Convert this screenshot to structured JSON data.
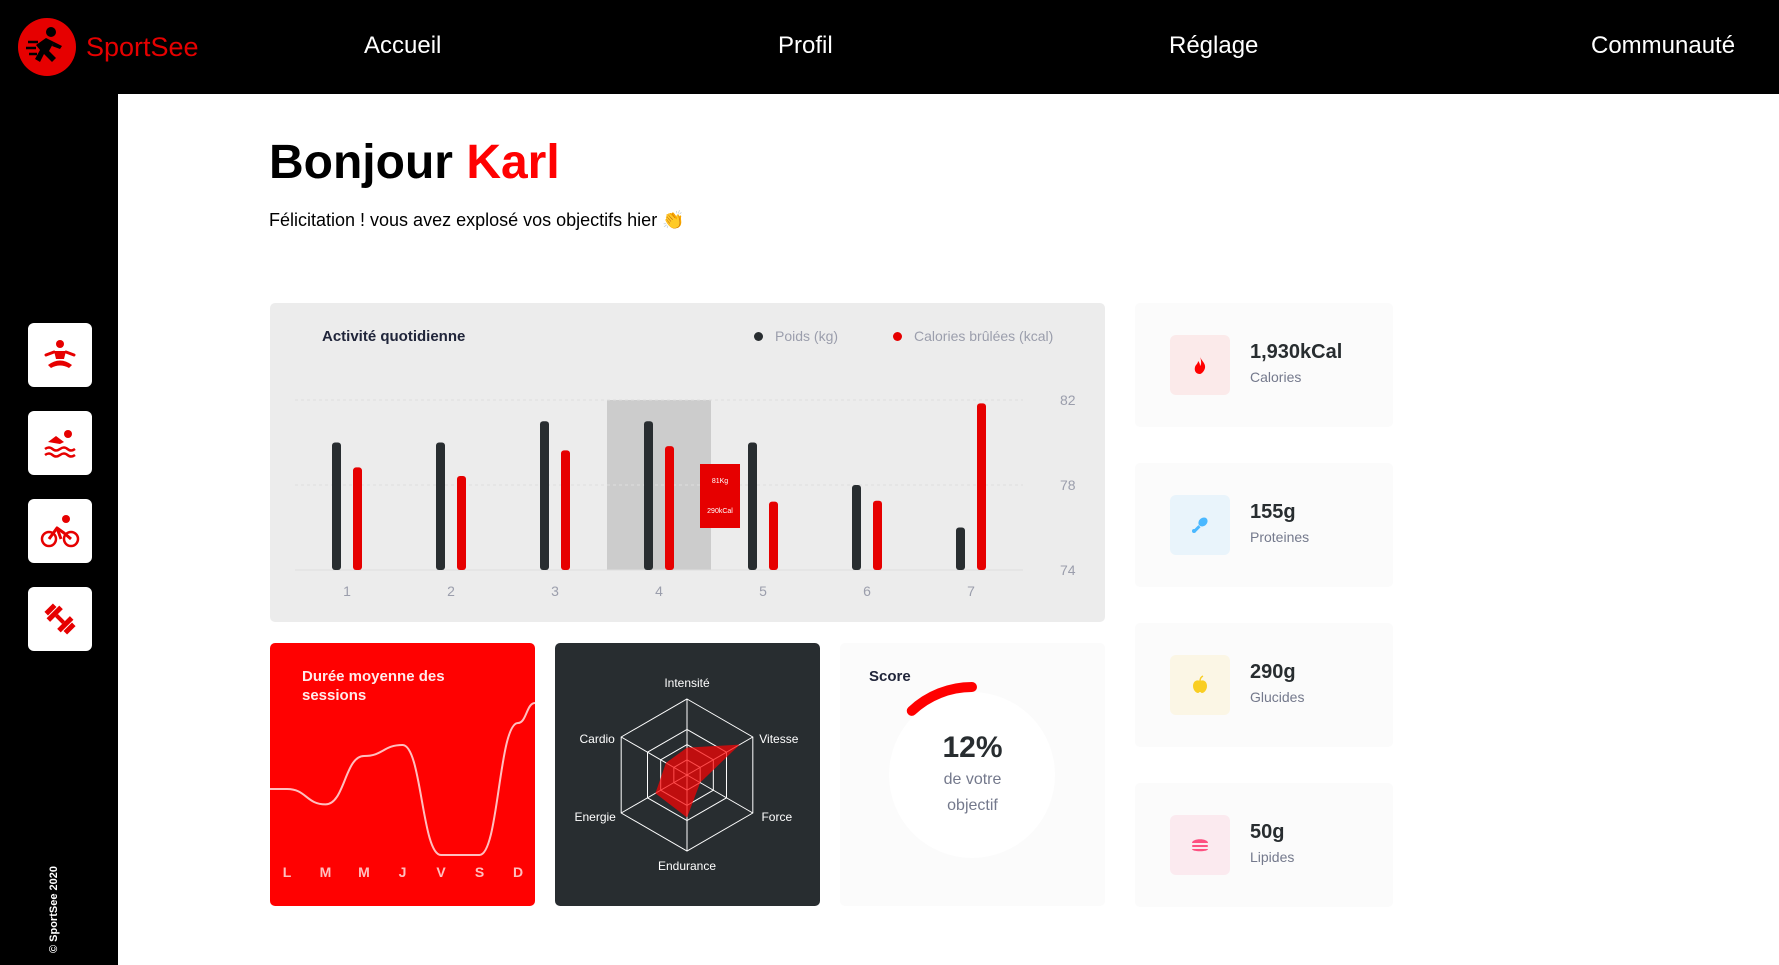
{
  "brand": {
    "name": "SportSee",
    "accent": "#E60000"
  },
  "nav": {
    "items": [
      "Accueil",
      "Profil",
      "Réglage",
      "Communauté"
    ]
  },
  "sidebar": {
    "icons": [
      "yoga-icon",
      "swimming-icon",
      "cycling-icon",
      "dumbbell-icon"
    ],
    "copyright": "© SportSee 2020"
  },
  "greeting": {
    "hello": "Bonjour",
    "name": "Karl",
    "message": "Félicitation ! vous avez explosé vos objectifs hier 👏"
  },
  "daily_activity": {
    "title": "Activité quotidienne",
    "legend": [
      "Poids (kg)",
      "Calories brûlées (kcal)"
    ],
    "tooltip": {
      "weight": "81Kg",
      "calories": "290kCal"
    }
  },
  "sessions": {
    "title": "Durée moyenne des sessions",
    "days": [
      "L",
      "M",
      "M",
      "J",
      "V",
      "S",
      "D"
    ]
  },
  "performance": {
    "labels": [
      "Intensité",
      "Vitesse",
      "Force",
      "Endurance",
      "Energie",
      "Cardio"
    ]
  },
  "score": {
    "title": "Score",
    "value": "12%",
    "line1": "de votre",
    "line2": "objectif"
  },
  "key_data": [
    {
      "value": "1,930kCal",
      "label": "Calories",
      "icon": "flame-icon",
      "color": "#FF0000",
      "bg": "#FBEAEA"
    },
    {
      "value": "155g",
      "label": "Proteines",
      "icon": "drumstick-icon",
      "color": "#4AB8FF",
      "bg": "#E9F4FB"
    },
    {
      "value": "290g",
      "label": "Glucides",
      "icon": "apple-icon",
      "color": "#F9CE23",
      "bg": "#FBF6E5"
    },
    {
      "value": "50g",
      "label": "Lipides",
      "icon": "burger-icon",
      "color": "#FD5181",
      "bg": "#FBEAEF"
    }
  ],
  "chart_data": [
    {
      "type": "bar",
      "title": "Activité quotidienne",
      "categories": [
        "1",
        "2",
        "3",
        "4",
        "5",
        "6",
        "7"
      ],
      "series": [
        {
          "name": "Poids (kg)",
          "values": [
            80,
            80,
            81,
            81,
            80,
            78,
            76
          ],
          "color": "#282D30"
        },
        {
          "name": "Calories brûlées (kcal)",
          "values": [
            240,
            220,
            280,
            290,
            160,
            162,
            390
          ],
          "color": "#E60000"
        }
      ],
      "y_ticks": [
        "82",
        "78",
        "74"
      ],
      "ylim": [
        74,
        82
      ],
      "highlight_category": "4"
    },
    {
      "type": "line",
      "title": "Durée moyenne des sessions",
      "categories": [
        "L",
        "M",
        "M",
        "J",
        "V",
        "S",
        "D"
      ],
      "values": [
        30,
        23,
        45,
        50,
        0,
        0,
        60
      ]
    },
    {
      "type": "radar",
      "categories": [
        "Intensité",
        "Vitesse",
        "Force",
        "Endurance",
        "Energie",
        "Cardio"
      ],
      "values": [
        90,
        200,
        50,
        140,
        120,
        80
      ]
    },
    {
      "type": "pie",
      "title": "Score",
      "values": [
        12
      ],
      "unit": "%"
    }
  ]
}
